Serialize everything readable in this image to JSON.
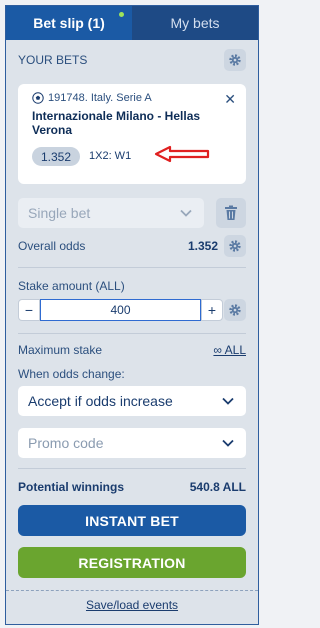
{
  "tabs": [
    {
      "label": "Bet slip (1)",
      "active": true
    },
    {
      "label": "My bets",
      "active": false
    }
  ],
  "your_bets": {
    "title": "YOUR BETS"
  },
  "bet": {
    "league": "191748. Italy. Serie A",
    "match": "Internazionale Milano - Hellas Verona",
    "odds": "1.352",
    "market": "1X2: W1"
  },
  "bet_type": {
    "value": "Single bet"
  },
  "overall_odds": {
    "label": "Overall odds",
    "value": "1.352"
  },
  "stake": {
    "label": "Stake amount (ALL)",
    "value": "400",
    "minus": "−",
    "plus": "+"
  },
  "max_stake": {
    "label": "Maximum stake",
    "value": "∞ ALL"
  },
  "odds_change": {
    "label": "When odds change:",
    "value": "Accept if odds increase"
  },
  "promo": {
    "placeholder": "Promo code"
  },
  "potential": {
    "label": "Potential winnings",
    "value": "540.8 ALL"
  },
  "buttons": {
    "instant": "INSTANT BET",
    "registration": "REGISTRATION"
  },
  "footer": {
    "save_link": "Save/load events"
  },
  "colors": {
    "primary": "#1b5aa5",
    "green": "#6aa52f",
    "arrow": "#e02020"
  }
}
